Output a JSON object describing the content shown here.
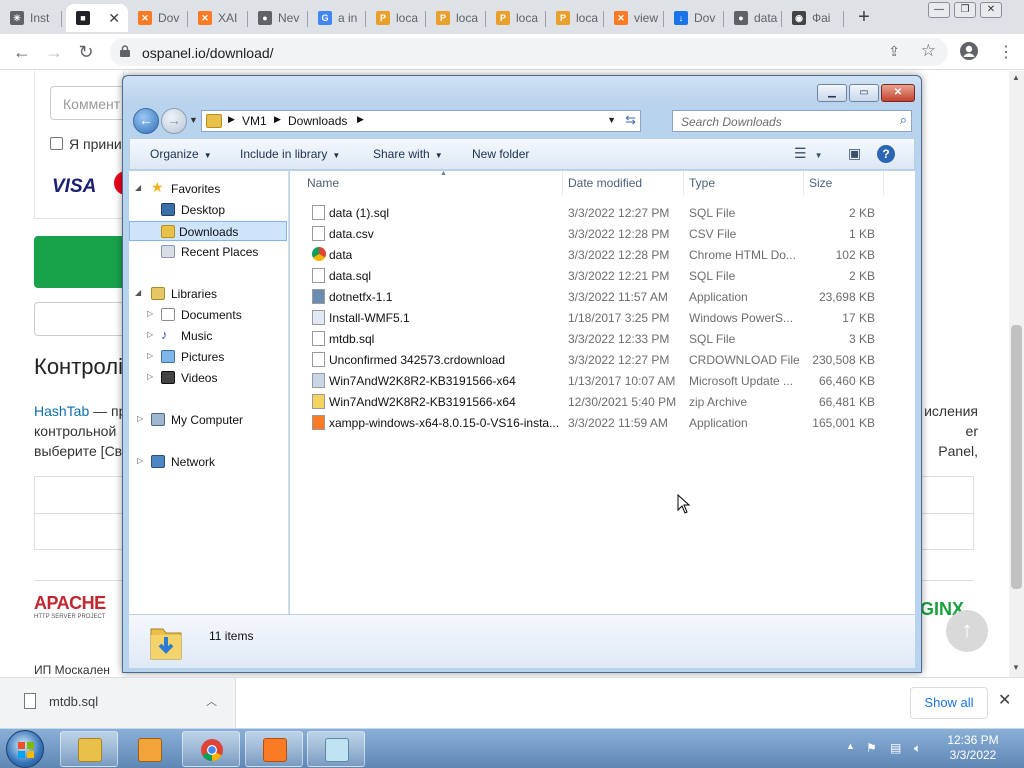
{
  "browser": {
    "tabs": [
      {
        "label": "Inst",
        "icon": "spinner-icon",
        "color": "#5f6368"
      },
      {
        "label": "",
        "icon": "terminal-icon",
        "color": "#202124",
        "active": true
      },
      {
        "label": "Dov",
        "icon": "xampp-icon",
        "color": "#fb7a24"
      },
      {
        "label": "XAI",
        "icon": "xampp-icon",
        "color": "#fb7a24"
      },
      {
        "label": "Nev",
        "icon": "chrome-icon",
        "color": "#5f6368"
      },
      {
        "label": "a in",
        "icon": "google-icon",
        "color": "#4285f4"
      },
      {
        "label": "loca",
        "icon": "phpmyadmin-icon",
        "color": "#e8a02b"
      },
      {
        "label": "loca",
        "icon": "phpmyadmin-icon",
        "color": "#e8a02b"
      },
      {
        "label": "loca",
        "icon": "phpmyadmin-icon",
        "color": "#e8a02b"
      },
      {
        "label": "loca",
        "icon": "phpmyadmin-icon",
        "color": "#e8a02b"
      },
      {
        "label": "view",
        "icon": "xampp-icon",
        "color": "#fb7a24"
      },
      {
        "label": "Dov",
        "icon": "download-icon",
        "color": "#1a73e8"
      },
      {
        "label": "data",
        "icon": "globe-icon",
        "color": "#5f6368"
      },
      {
        "label": "Фаі",
        "icon": "eye-icon",
        "color": "#444"
      }
    ],
    "new_tab": "+",
    "url": "ospanel.io/download/"
  },
  "webpage": {
    "comment_placeholder": "Коммент",
    "accept_text": "Я прини",
    "visa": "VISA",
    "heading": "Контролі",
    "para_link": "HashTab",
    "para_left": " — пр контрольной выберите [Све",
    "para_right": "исления er Panel,",
    "apache": "APACHE",
    "apache_sub": "HTTP SERVER PROJECT",
    "nginx": "GINX",
    "footer": "ИП Москален"
  },
  "explorer": {
    "breadcrumb": [
      "VM1",
      "Downloads"
    ],
    "search_placeholder": "Search Downloads",
    "commands": {
      "organize": "Organize",
      "include": "Include in library",
      "share": "Share with",
      "new_folder": "New folder"
    },
    "nav": {
      "favorites": "Favorites",
      "desktop": "Desktop",
      "downloads": "Downloads",
      "recent": "Recent Places",
      "libraries": "Libraries",
      "documents": "Documents",
      "music": "Music",
      "pictures": "Pictures",
      "videos": "Videos",
      "computer": "My Computer",
      "network": "Network"
    },
    "columns": {
      "name": "Name",
      "date": "Date modified",
      "type": "Type",
      "size": "Size"
    },
    "files": [
      {
        "name": "data (1).sql",
        "date": "3/3/2022 12:27 PM",
        "type": "SQL File",
        "size": "2 KB",
        "icon": "doc-icon"
      },
      {
        "name": "data.csv",
        "date": "3/3/2022 12:28 PM",
        "type": "CSV File",
        "size": "1 KB",
        "icon": "doc-icon"
      },
      {
        "name": "data",
        "date": "3/3/2022 12:28 PM",
        "type": "Chrome HTML Do...",
        "size": "102 KB",
        "icon": "chrome-icon"
      },
      {
        "name": "data.sql",
        "date": "3/3/2022 12:21 PM",
        "type": "SQL File",
        "size": "2 KB",
        "icon": "doc-icon"
      },
      {
        "name": "dotnetfx-1.1",
        "date": "3/3/2022 11:57 AM",
        "type": "Application",
        "size": "23,698 KB",
        "icon": "installer-icon"
      },
      {
        "name": "Install-WMF5.1",
        "date": "1/18/2017 3:25 PM",
        "type": "Windows PowerS...",
        "size": "17 KB",
        "icon": "script-icon"
      },
      {
        "name": "mtdb.sql",
        "date": "3/3/2022 12:33 PM",
        "type": "SQL File",
        "size": "3 KB",
        "icon": "doc-icon"
      },
      {
        "name": "Unconfirmed 342573.crdownload",
        "date": "3/3/2022 12:27 PM",
        "type": "CRDOWNLOAD File",
        "size": "230,508 KB",
        "icon": "doc-icon"
      },
      {
        "name": "Win7AndW2K8R2-KB3191566-x64",
        "date": "1/13/2017 10:07 AM",
        "type": "Microsoft Update ...",
        "size": "66,460 KB",
        "icon": "update-icon"
      },
      {
        "name": "Win7AndW2K8R2-KB3191566-x64",
        "date": "12/30/2021 5:40 PM",
        "type": "zip Archive",
        "size": "66,481 KB",
        "icon": "zip-icon"
      },
      {
        "name": "xampp-windows-x64-8.0.15-0-VS16-insta...",
        "date": "3/3/2022 11:59 AM",
        "type": "Application",
        "size": "165,001 KB",
        "icon": "xampp-icon"
      }
    ],
    "item_count": "11 items"
  },
  "downloads": {
    "item": "mtdb.sql",
    "show_all": "Show all"
  },
  "taskbar": {
    "time": "12:36 PM",
    "date": "3/3/2022"
  },
  "colors": {
    "accent": "#1a73e8",
    "win7_blue": "#2b66b5",
    "selection": "#cde4fb"
  }
}
